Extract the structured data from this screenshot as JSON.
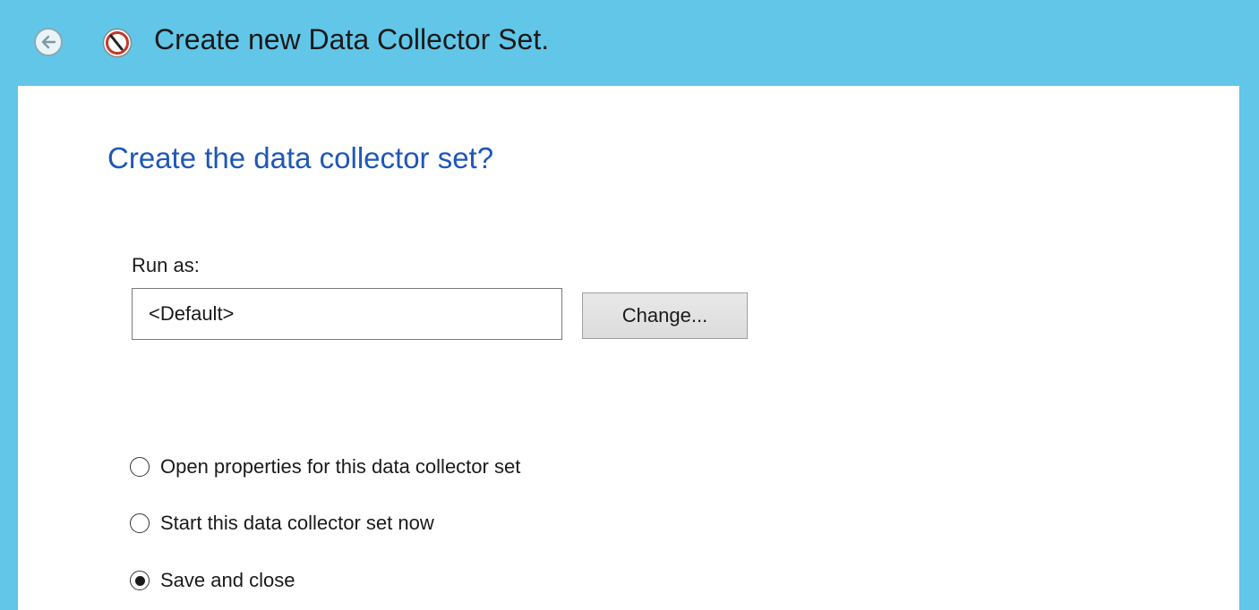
{
  "window": {
    "title": "Create new Data Collector Set.",
    "back_icon": "back-arrow-icon",
    "app_icon": "performance-monitor-icon",
    "accent_color": "#62c6e8"
  },
  "page": {
    "heading": "Create the data collector set?",
    "heading_color": "#1f57b8"
  },
  "run_as": {
    "label": "Run as:",
    "value": "<Default>",
    "change_button_label": "Change..."
  },
  "options": [
    {
      "label": "Open properties for this data collector set",
      "selected": false
    },
    {
      "label": "Start this data collector set now",
      "selected": false
    },
    {
      "label": "Save and close",
      "selected": true
    }
  ]
}
